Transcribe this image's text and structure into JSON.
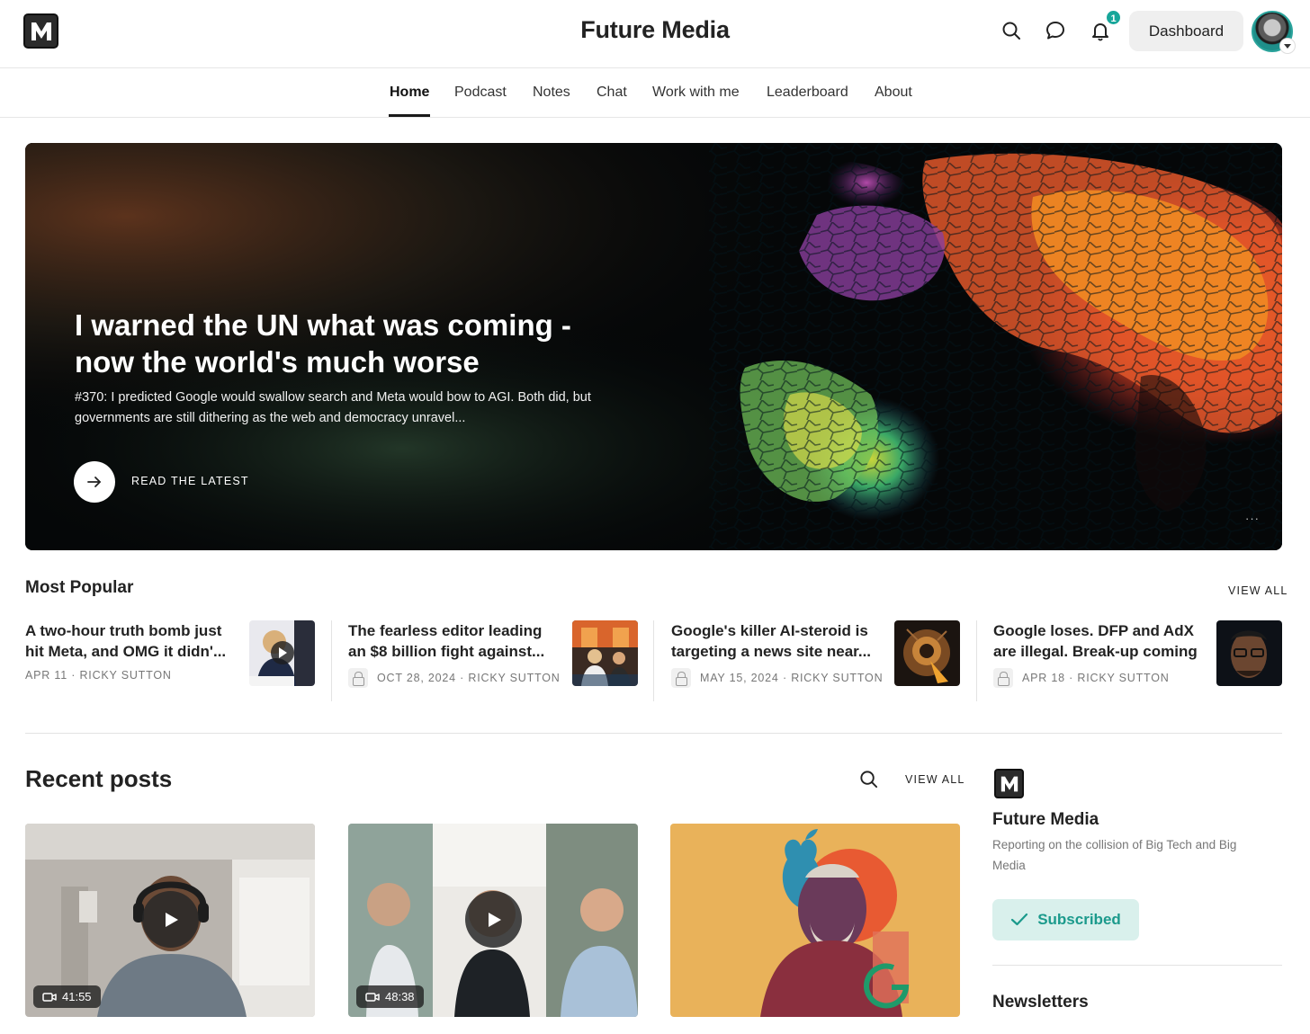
{
  "header": {
    "site_title": "Future Media",
    "logo_letter": "M",
    "notification_count": "1",
    "dashboard_label": "Dashboard",
    "icons": [
      "search-icon",
      "chat-bubble-icon",
      "bell-icon"
    ]
  },
  "nav": {
    "items": [
      {
        "label": "Home",
        "active": true
      },
      {
        "label": "Podcast"
      },
      {
        "label": "Notes"
      },
      {
        "label": "Chat"
      },
      {
        "label": "Work with me"
      },
      {
        "label": "Leaderboard"
      },
      {
        "label": "About"
      }
    ]
  },
  "hero": {
    "title": "I warned the UN what was coming - now the world's much worse",
    "subtitle": "#370: I predicted Google would swallow search and Meta would bow to AGI. Both did, but governments are still dithering as the web and democracy unravel...",
    "cta_label": "READ THE LATEST",
    "more_label": "···"
  },
  "most_popular": {
    "title": "Most Popular",
    "view_all": "VIEW ALL",
    "items": [
      {
        "title": "A two-hour truth bomb just hit Meta, and OMG it didn'...",
        "date": "APR 11",
        "author": "RICKY SUTTON",
        "locked": false,
        "video": true
      },
      {
        "title": "The fearless editor leading an $8 billion fight against...",
        "date": "OCT 28, 2024",
        "author": "RICKY SUTTON",
        "locked": true
      },
      {
        "title": "Google's killer AI-steroid is targeting a news site near...",
        "date": "MAY 15, 2024",
        "author": "RICKY SUTTON",
        "locked": true
      },
      {
        "title": "Google loses. DFP and AdX are illegal. Break-up coming",
        "date": "APR 18",
        "author": "RICKY SUTTON",
        "locked": true
      }
    ]
  },
  "recent_posts": {
    "title": "Recent posts",
    "view_all": "VIEW ALL",
    "items": [
      {
        "type": "video",
        "duration": "41:55"
      },
      {
        "type": "video",
        "duration": "48:38"
      },
      {
        "type": "image"
      }
    ]
  },
  "sidebar": {
    "name": "Future Media",
    "description": "Reporting on the collision of Big Tech and Big Media",
    "subscribed_label": "Subscribed",
    "newsletters_heading": "Newsletters"
  },
  "colors": {
    "accent": "#17a69a",
    "subscribed_bg": "#d9f0ec",
    "subscribed_text": "#1b9a8c"
  }
}
